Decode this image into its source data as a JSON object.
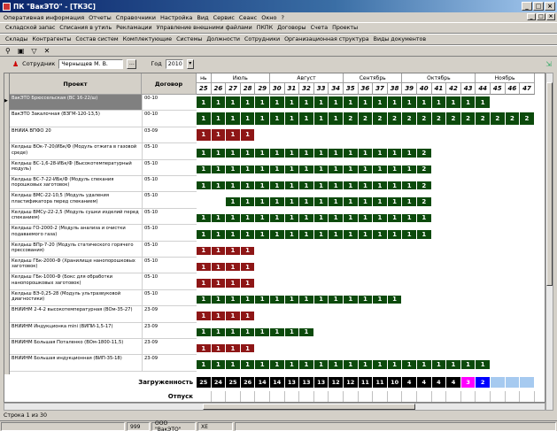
{
  "window": {
    "title": "ПК \"ВакЭТО\" - [ТКЗС]"
  },
  "menu": [
    "Оперативная информация",
    "Отчеты",
    "Справочники",
    "Настройка",
    "Вид",
    "Сервис",
    "Сеанс",
    "Окно",
    "?"
  ],
  "toolbar1": [
    "Складской запас",
    "Списания в утиль",
    "Рекламации",
    "Управление внешними файлами",
    "ПКПК",
    "Договоры",
    "Счета",
    "Проекты"
  ],
  "toolbar2": [
    "Склады",
    "Контрагенты",
    "Состав систем",
    "Комплектующие",
    "Системы",
    "Должности",
    "Сотрудники",
    "Организационная структура",
    "Виды документов"
  ],
  "filter": {
    "employee_label": "Сотрудник",
    "employee_value": "Черныщев М. В.",
    "year_label": "Год",
    "year_value": "2010"
  },
  "grid": {
    "col_project": "Проект",
    "col_contract": "Договор",
    "months": [
      "нь",
      "Июль",
      "Август",
      "Сентябрь",
      "Октябрь",
      "Ноябрь"
    ],
    "weeks": [
      "25",
      "26",
      "27",
      "28",
      "29",
      "30",
      "31",
      "32",
      "33",
      "34",
      "35",
      "36",
      "37",
      "38",
      "39",
      "40",
      "41",
      "42",
      "43",
      "44",
      "45",
      "46",
      "47"
    ],
    "rows": [
      {
        "project": "ВакЭТО Брюссельская (ВС 16-22/ш)",
        "contract": "00-10",
        "cells": "GGGGGGGGGGGGGGGGGGGG"
      },
      {
        "project": "ВакЭТО Закалочная (ВЗГМ-120-13,5)",
        "contract": "00-10",
        "cells": "GGGGGGGGGGGGGGGGGGGGGGG",
        "vals": "11111111112222222222222"
      },
      {
        "project": "ВНИИА ВПФО 20",
        "contract": "03-09",
        "cells": "RRRR"
      },
      {
        "project": "Келдыш ВОк-7-20/ИБк/Ф (Модуль отжига в газовой среде)",
        "contract": "05-10",
        "cells": "GGGGGGGGGGGGGGGG",
        "vals": "1111111111111112"
      },
      {
        "project": "Келдыш ВС-1,6-28-ИБк/Ф (Высокотемпературный модуль)",
        "contract": "05-10",
        "cells": "GGGGGGGGGGGGGGGG",
        "vals": "1111111111111112"
      },
      {
        "project": "Келдыш ВС-7-22-ИБк/Ф (Модуль спекания порошковых заготовок)",
        "contract": "05-10",
        "cells": "GGGGGGGGGGGGGGGG",
        "vals": "1111111111111112"
      },
      {
        "project": "Келдыш ВМС-22-10,5 (Модуль удаления пластификатора перед спеканием)",
        "contract": "05-10",
        "cells": "..GGGGGGGGGGGGGG",
        "vals": "..11111111111112"
      },
      {
        "project": "Келдыш ВМСу-22-2,5 (Модуль сушки изделий перед спеканием)",
        "contract": "05-10",
        "cells": "GGGGGGGGGGGGGGGG"
      },
      {
        "project": "Келдыш ГО-2000-2 (Модуль анализа и очистки подаваемого газа)",
        "contract": "05-10",
        "cells": "GGGGGGGGGGGGGGGG"
      },
      {
        "project": "Келдыш ВПр-7-20 (Модуль статического горячего прессования)",
        "contract": "05-10",
        "cells": "RRRR"
      },
      {
        "project": "Келдыш ГБк-2000-Ф (Хранилище нанопорошковых заготовок)",
        "contract": "05-10",
        "cells": "RRRR"
      },
      {
        "project": "Келдыш ГБк-1000-Ф (Бокс для обработки нанопорошковых заготовок)",
        "contract": "05-10",
        "cells": "RRRR"
      },
      {
        "project": "Келдыш ВЭ-0,25-28 (Модуль ультразвуковой диагностики)",
        "contract": "05-10",
        "cells": "GGGGGGGGGGGGGG"
      },
      {
        "project": "ВНИИНМ 2-4-2 высокотемпературная (ВОм-35-27)",
        "contract": "23-09",
        "cells": "RRRR"
      },
      {
        "project": "ВНИИНМ Индукционка mini (ВИПИ-1,5-17)",
        "contract": "23-09",
        "cells": "GGGGGGGG"
      },
      {
        "project": "ВНИИНМ Большая Поталенко (ВОм-1800-11,5)",
        "contract": "23-09",
        "cells": "RRRR"
      },
      {
        "project": "ВНИИНМ Большая индукционная (ВИП-35-18)",
        "contract": "23-09",
        "cells": "GGGGGGGGGGGGGGGGGGGG"
      }
    ],
    "load_label": "Загруженность",
    "release_label": "Отпуск",
    "load": [
      "25",
      "24",
      "25",
      "26",
      "14",
      "14",
      "13",
      "13",
      "13",
      "12",
      "12",
      "11",
      "11",
      "10",
      "4",
      "4",
      "4",
      "4",
      "3",
      "2",
      "",
      "",
      ""
    ],
    "load_colors": [
      "#000000",
      "#000000",
      "#000000",
      "#000000",
      "#000000",
      "#000000",
      "#000000",
      "#000000",
      "#000000",
      "#000000",
      "#000000",
      "#000000",
      "#000000",
      "#000000",
      "#000000",
      "#000000",
      "#000000",
      "#000000",
      "#ff00ff",
      "#0000ff",
      "#a6caf0",
      "#a6caf0",
      "#a6caf0"
    ]
  },
  "status": {
    "rows": "Строка 1 из 30",
    "code": "999",
    "org": "ООО \"ВакЭТО\"",
    "user": "ХЕ"
  }
}
